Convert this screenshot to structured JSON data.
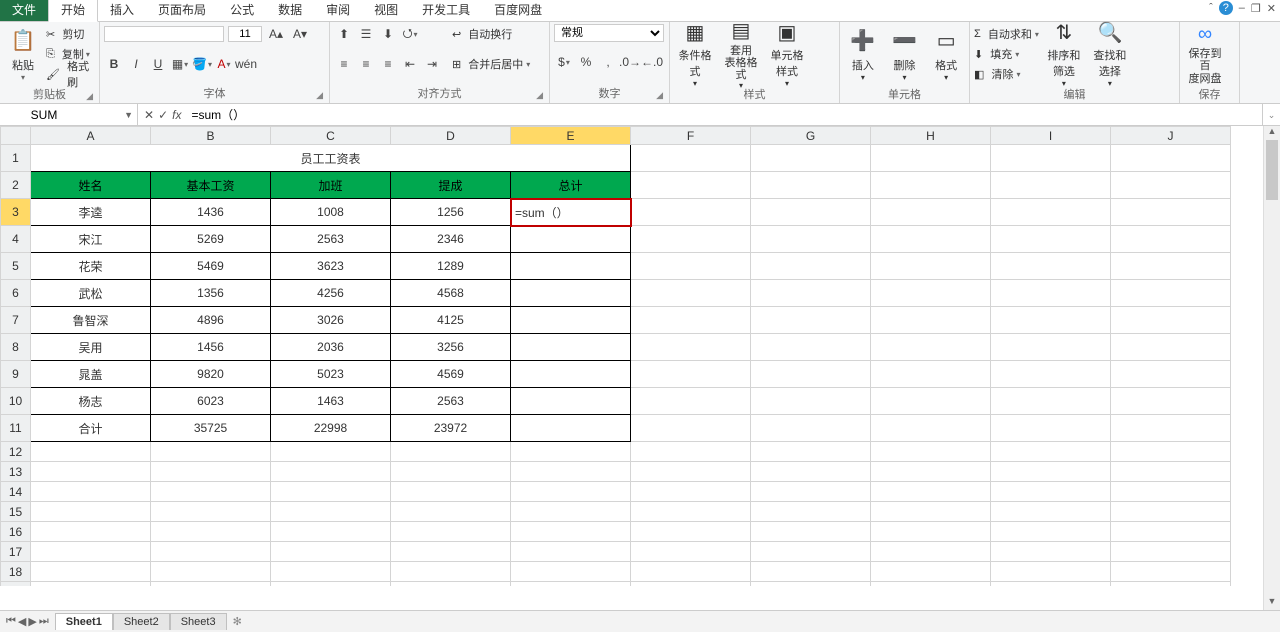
{
  "titlebar": {
    "help_icon": "?",
    "min": "–",
    "restore": "❐",
    "close": "✕",
    "up": "ˆ"
  },
  "tabs": {
    "file": "文件",
    "items": [
      "开始",
      "插入",
      "页面布局",
      "公式",
      "数据",
      "审阅",
      "视图",
      "开发工具",
      "百度网盘"
    ],
    "active": "开始"
  },
  "ribbon": {
    "clipboard": {
      "paste": "粘贴",
      "cut": "剪切",
      "copy": "复制",
      "format_painter": "格式刷",
      "label": "剪贴板"
    },
    "font": {
      "name": "",
      "size": "11",
      "bold": "B",
      "italic": "I",
      "underline": "U",
      "label": "字体"
    },
    "alignment": {
      "wrap": "自动换行",
      "merge": "合并后居中",
      "label": "对齐方式"
    },
    "number": {
      "format": "常规",
      "label": "数字"
    },
    "styles": {
      "cond": "条件格式",
      "table": "套用\n表格格式",
      "cell": "单元格样式",
      "label": "样式"
    },
    "cells": {
      "insert": "插入",
      "delete": "删除",
      "format": "格式",
      "label": "单元格"
    },
    "editing": {
      "autosum": "自动求和",
      "fill": "填充",
      "clear": "清除",
      "sort": "排序和筛选",
      "find": "查找和选择",
      "label": "编辑"
    },
    "save": {
      "btn": "保存到百\n度网盘",
      "label": "保存"
    }
  },
  "formula_bar": {
    "name": "SUM",
    "value": "=sum（）"
  },
  "columns": [
    "A",
    "B",
    "C",
    "D",
    "E",
    "F",
    "G",
    "H",
    "I",
    "J"
  ],
  "active_col": "E",
  "active_row": 3,
  "sheet": {
    "title": "员工工资表",
    "headers": [
      "姓名",
      "基本工资",
      "加班",
      "提成",
      "总计"
    ],
    "rows": [
      {
        "n": "李逵",
        "b": "1436",
        "o": "1008",
        "c": "1256"
      },
      {
        "n": "宋江",
        "b": "5269",
        "o": "2563",
        "c": "2346"
      },
      {
        "n": "花荣",
        "b": "5469",
        "o": "3623",
        "c": "1289"
      },
      {
        "n": "武松",
        "b": "1356",
        "o": "4256",
        "c": "4568"
      },
      {
        "n": "鲁智深",
        "b": "4896",
        "o": "3026",
        "c": "4125"
      },
      {
        "n": "吴用",
        "b": "1456",
        "o": "2036",
        "c": "3256"
      },
      {
        "n": "晁盖",
        "b": "9820",
        "o": "5023",
        "c": "4569"
      },
      {
        "n": "杨志",
        "b": "6023",
        "o": "1463",
        "c": "2563"
      }
    ],
    "total_row": {
      "n": "合计",
      "b": "35725",
      "o": "22998",
      "c": "23972"
    },
    "editing_value": "=sum（）"
  },
  "sheets": {
    "items": [
      "Sheet1",
      "Sheet2",
      "Sheet3"
    ],
    "active": "Sheet1"
  }
}
